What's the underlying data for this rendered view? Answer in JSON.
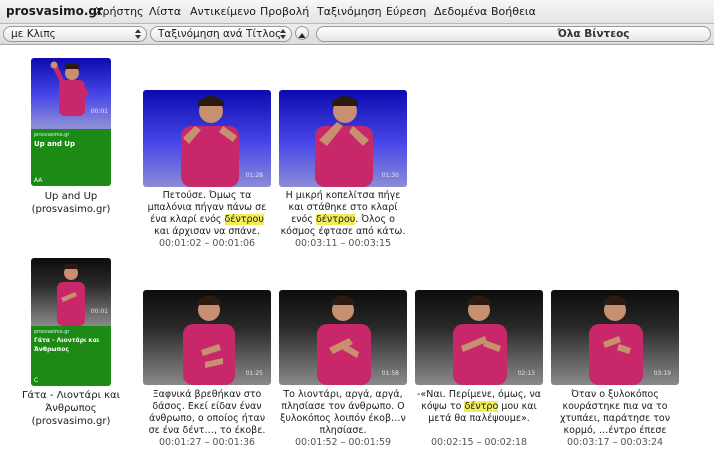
{
  "app": {
    "name": "prosvasimo.gr"
  },
  "menu": [
    "Χρήστης",
    "Λίστα",
    "Αντικείμενο",
    "Προβολή",
    "Ταξινόμηση",
    "Εύρεση",
    "Δεδομένα",
    "Βοήθεια"
  ],
  "toolbar": {
    "filter_value": "με Κλιπς",
    "sort_value": "Ταξινόμηση ανά Τίτλος",
    "scope_label": "Όλα Βίντεος"
  },
  "groups": [
    {
      "title_card": {
        "site": "prosvasimo.gr",
        "title": "Up and Up",
        "code": "AA",
        "caption": "Up and Up (prosvasimo.gr)",
        "timecode": "00:01"
      },
      "clips": [
        {
          "caption_before": "Πετούσε. Όμως τα μπαλόνια πήγαν πάνω σε ένα κλαρί ενός ",
          "highlight": "δέντρου",
          "caption_after": " και άρχισαν να σπάνε.",
          "time": "00:01:02 – 00:01:06",
          "timecode": "01:28"
        },
        {
          "caption_before": "Η μικρή κοπελίτσα πήγε και στάθηκε στο κλαρί ενός ",
          "highlight": "δέντρου",
          "caption_after": ". Όλος ο κόσμος έφτασε από κάτω.",
          "time": "00:03:11 – 00:03:15",
          "timecode": "01:30"
        }
      ]
    },
    {
      "title_card": {
        "site": "prosvasimo.gr",
        "title": "Γάτα - Λιοντάρι και Άνθρωπος",
        "code": "C",
        "caption": "Γάτα - Λιοντάρι και Άνθρωπος (prosvasimo.gr)",
        "timecode": "00:01"
      },
      "clips": [
        {
          "caption_before": "Ξαφνικά βρεθήκαν στο δάσος. Εκεί είδαν έναν άνθρωπο, ο οποίος ήταν σε ένα δέντ…, το έκοβε.",
          "highlight": "",
          "caption_after": "",
          "time": "00:01:27 – 00:01:36",
          "timecode": "01:25"
        },
        {
          "caption_before": "Το λιοντάρι, αργά, αργά, πλησίασε τον άνθρωπο. Ο ξυλοκόπος λοιπόν έκοβ…ν πλησίασε.",
          "highlight": "",
          "caption_after": "",
          "time": "00:01:52 – 00:01:59",
          "timecode": "01:58"
        },
        {
          "caption_before": "-«Ναι. Περίμενε, όμως, να κόψω το ",
          "highlight": "δέντρο",
          "caption_after": " μου και μετά θα παλέψουμε».",
          "time": "00:02:15 – 00:02:18",
          "timecode": "02:13"
        },
        {
          "caption_before": "Όταν ο ξυλοκόπος κουράστηκε πια να το χτυπάει, παράτησε τον κορμό, …έντρο έπεσε",
          "highlight": "",
          "caption_after": "",
          "time": "00:03:17 – 00:03:24",
          "timecode": "03:19"
        }
      ]
    }
  ],
  "colors": {
    "accent_highlight": "#f2ee5a",
    "title_card_green": "#1c8a14",
    "shirt": "#c8286a",
    "blue_background": "#2a2ad0"
  }
}
